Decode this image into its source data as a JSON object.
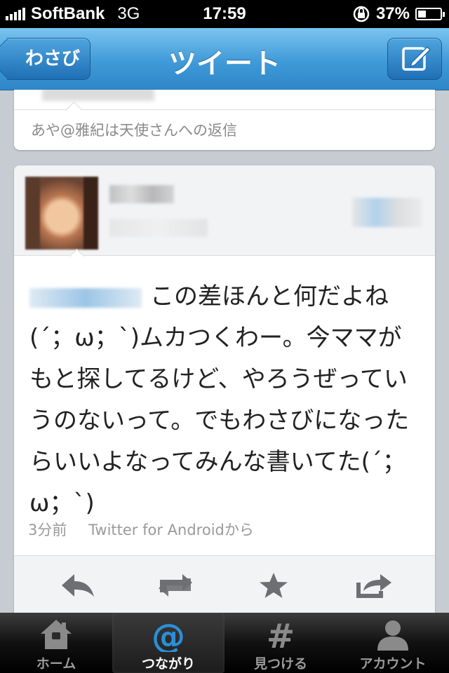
{
  "status_bar": {
    "carrier": "SoftBank",
    "network": "3G",
    "time": "17:59",
    "battery": "37%",
    "battery_level": 0.37
  },
  "nav": {
    "back_label": "わさび",
    "title": "ツイート"
  },
  "previous_tweet": {
    "reply_text": "あや@雅紀は天使さんへの返信"
  },
  "tweet": {
    "text": "この差ほんと何だよね(´；ω；`)ムカつくわー。今ママがもと探してるけど、やろうぜっていうのないって。でもわさびになったらいいよなってみんな書いてた(´；ω；`)",
    "time_ago": "3分前",
    "via": "Twitter for Androidから"
  },
  "actions": [
    "reply-icon",
    "retweet-icon",
    "favorite-icon",
    "share-icon"
  ],
  "tab_bar": {
    "items": [
      {
        "label": "ホーム",
        "icon": "home-icon"
      },
      {
        "label": "つながり",
        "icon": "at-sign-icon",
        "selected": true
      },
      {
        "label": "見つける",
        "icon": "hashtag-icon"
      },
      {
        "label": "アカウント",
        "icon": "person-icon"
      }
    ]
  },
  "colors": {
    "nav_blue": "#3f9ad8",
    "accent_blue": "#2b8fd6",
    "tab_bar": "#111111"
  }
}
